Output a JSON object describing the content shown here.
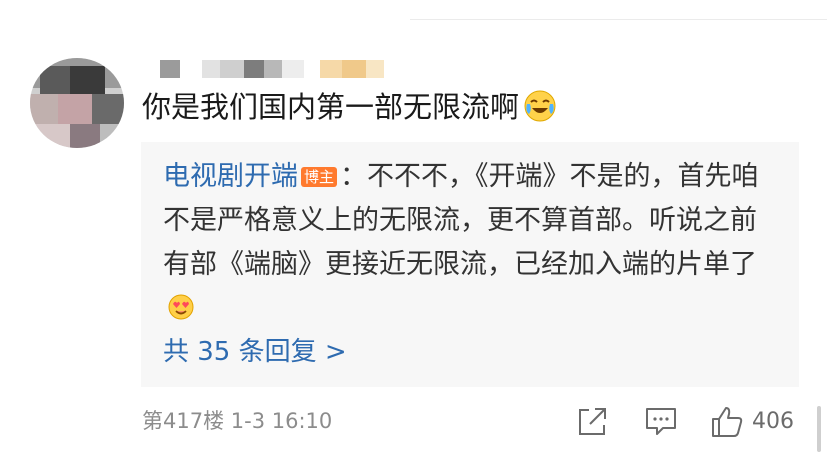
{
  "comment": {
    "text": "你是我们国内第一部无限流啊",
    "emoji": "crying-laughing-emoji"
  },
  "reply": {
    "author": "电视剧开端",
    "badge": "博主",
    "text": "：不不不，《开端》不是的，首先咱不是严格意义上的无限流，更不算首部。听说之前有部《端脑》更接近无限流，已经加入端的片单了",
    "emoji": "heart-eyes-emoji"
  },
  "more_replies": "共 35 条回复 >",
  "meta": {
    "floor_time": "第417楼  1-3 16:10"
  },
  "actions": {
    "share_icon": "share-icon",
    "comment_icon": "comment-icon",
    "like_icon": "thumbs-up-icon",
    "like_count": "406"
  },
  "colors": {
    "link": "#2e6bb0",
    "badge": "#ff7a2e",
    "reply_bg": "#f7f7f7",
    "meta": "#8c8c8c"
  }
}
